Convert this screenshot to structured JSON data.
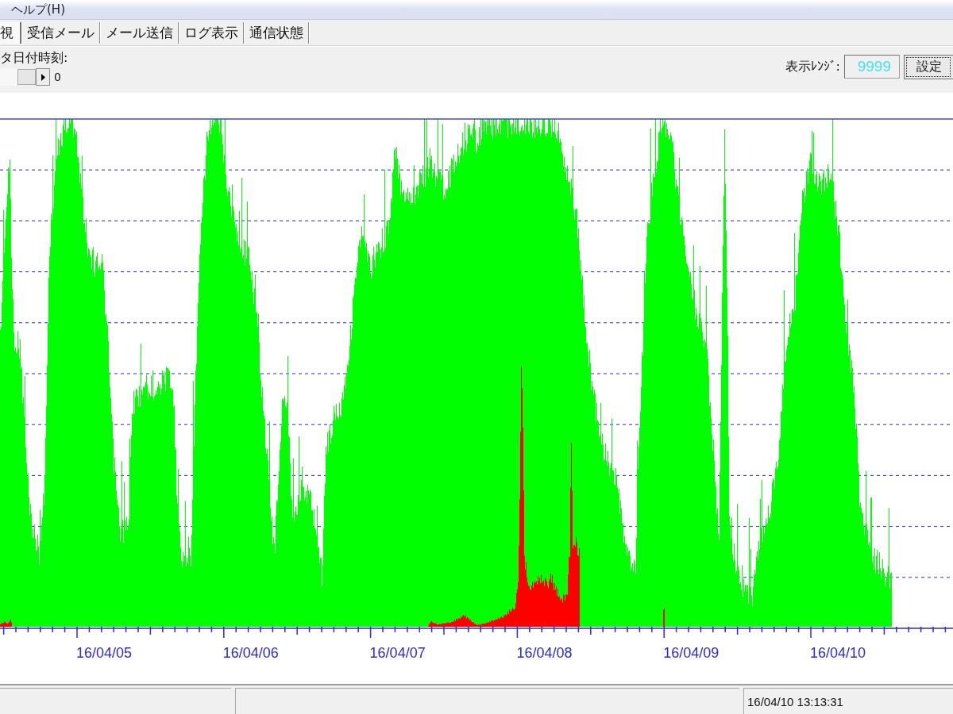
{
  "menu_bar": {
    "items": [
      {
        "label": "ヘルプ(H)"
      }
    ]
  },
  "tabs": [
    {
      "label": "視",
      "selected": true
    },
    {
      "label": "受信メール",
      "selected": false
    },
    {
      "label": "メール送信",
      "selected": false
    },
    {
      "label": "ログ表示",
      "selected": false
    },
    {
      "label": "通信状態",
      "selected": false
    }
  ],
  "toolbar": {
    "date_label": "タ日付時刻:",
    "slider_value": "0",
    "range_label": "表示ﾚﾝｼﾞ:",
    "range_value": "9999",
    "set_button": "設定"
  },
  "chart": {
    "x_labels": [
      "16/04/05",
      "16/04/06",
      "16/04/07",
      "16/04/08",
      "16/04/09",
      "16/04/10"
    ]
  },
  "status_bar": {
    "time": "16/04/10 13:13:31"
  }
}
